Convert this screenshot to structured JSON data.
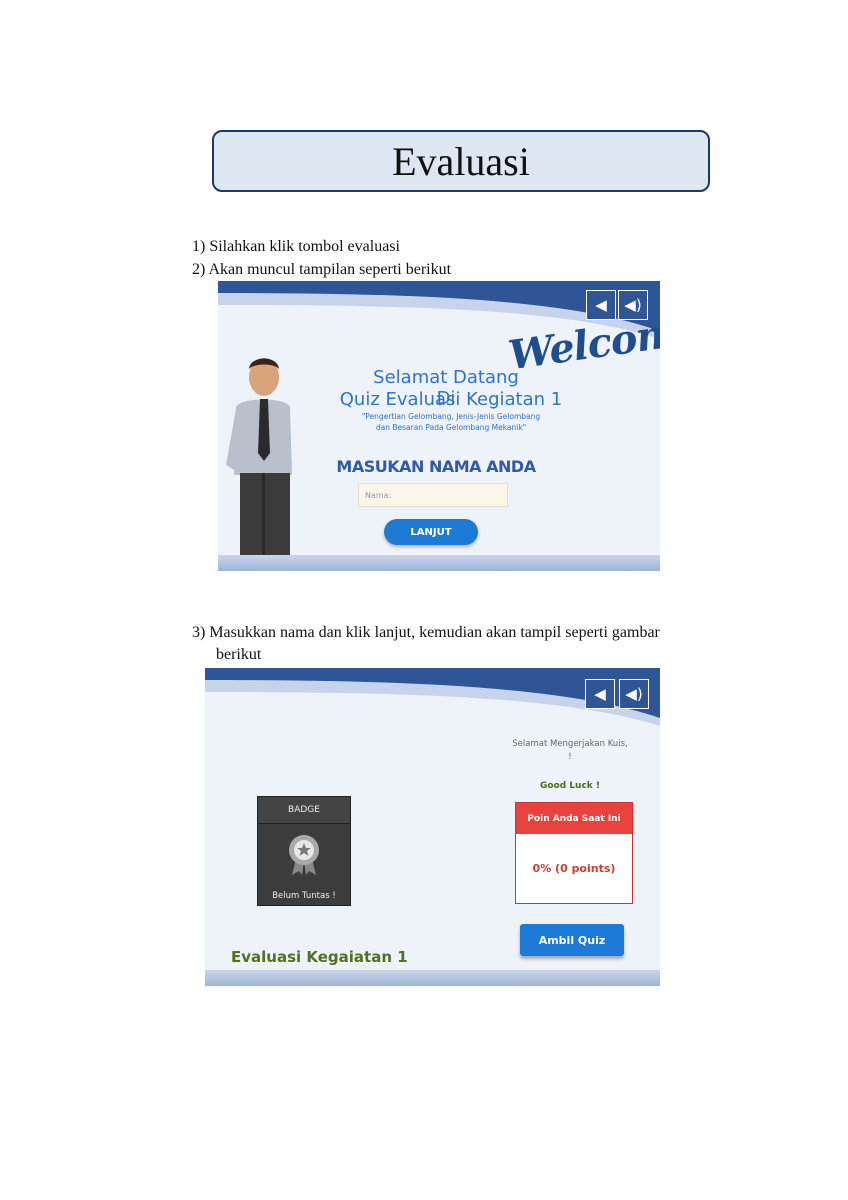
{
  "title": "Evaluasi",
  "steps": [
    "1) Silahkan klik tombol evaluasi",
    "2) Akan muncul tampilan seperti berikut",
    "3) Masukkan nama dan klik lanjut, kemudian akan tampil seperti gambar",
    "berikut"
  ],
  "screenshot1": {
    "welcome": "Welcome",
    "heading_line1": "Selamat Datang Di",
    "heading_line2": "Quiz Evaluasi Kegiatan 1",
    "subtitle_line1": "\"Pengertian Gelombang, Jenis-Jenis Gelombang",
    "subtitle_line2": "dan Besaran Pada Gelombang Mekanik\"",
    "name_heading": "MASUKAN NAMA ANDA",
    "name_placeholder": "Nama:",
    "button": "LANJUT",
    "icons": [
      "mute-icon",
      "volume-icon"
    ]
  },
  "screenshot2": {
    "greeting_line1": "Selamat Mengerjakan Kuis,",
    "greeting_line2": "!",
    "good_luck": "Good Luck !",
    "points_header": "Poin Anda Saat Ini",
    "points_value": "0% (0 points)",
    "button": "Ambil Quiz",
    "badge_title": "BADGE",
    "badge_status": "Belum Tuntas !",
    "footer_title": "Evaluasi Kegaiatan 1",
    "icons": [
      "mute-icon",
      "volume-icon",
      "award-ribbon-icon"
    ]
  }
}
